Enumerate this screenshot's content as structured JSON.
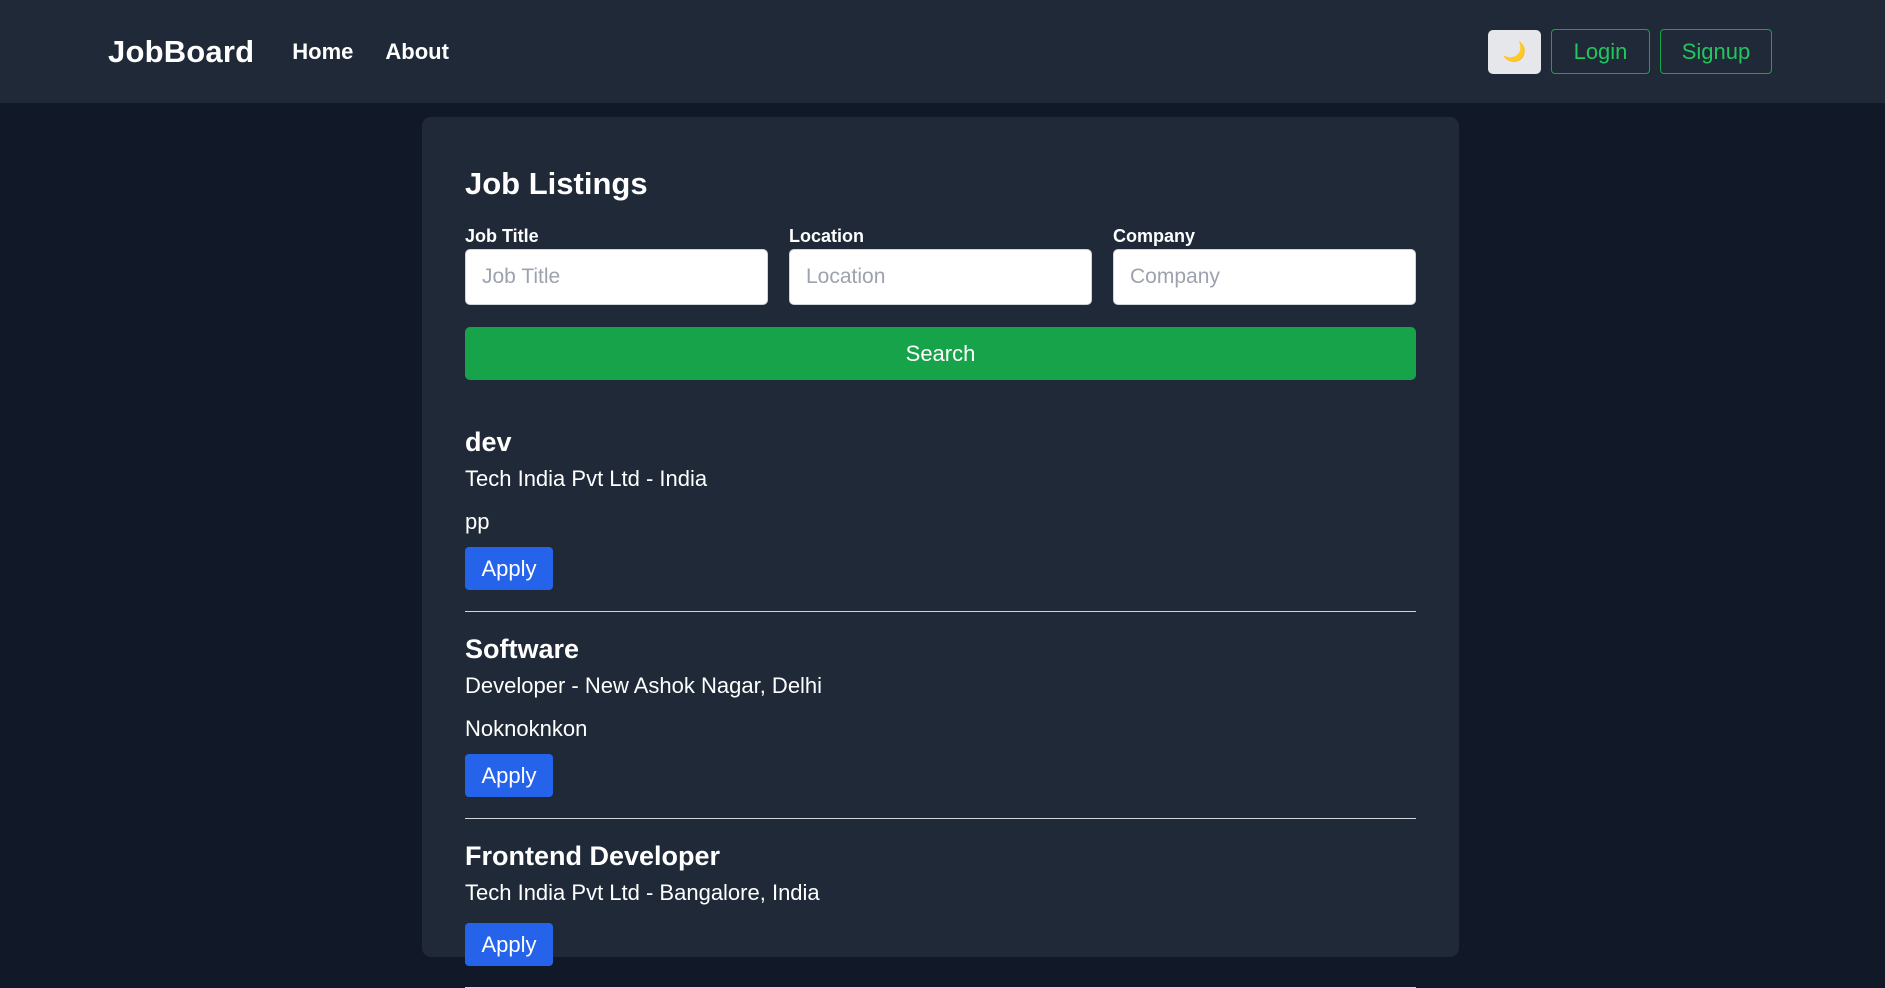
{
  "navbar": {
    "brand": "JobBoard",
    "links": [
      "Home",
      "About"
    ],
    "theme_icon": "🌙",
    "login_label": "Login",
    "signup_label": "Signup"
  },
  "main": {
    "title": "Job Listings",
    "filters": [
      {
        "label": "Job Title",
        "placeholder": "Job Title",
        "value": ""
      },
      {
        "label": "Location",
        "placeholder": "Location",
        "value": ""
      },
      {
        "label": "Company",
        "placeholder": "Company",
        "value": ""
      }
    ],
    "search_label": "Search",
    "jobs": [
      {
        "title": "dev",
        "meta": "Tech India Pvt Ltd - India",
        "description": "pp",
        "apply_label": "Apply"
      },
      {
        "title": "Software",
        "meta": "Developer - New Ashok Nagar, Delhi",
        "description": "Noknoknkon",
        "apply_label": "Apply"
      },
      {
        "title": "Frontend Developer",
        "meta": "Tech India Pvt Ltd - Bangalore, India",
        "description": "",
        "apply_label": "Apply"
      }
    ]
  },
  "colors": {
    "page_bg": "#111827",
    "panel_bg": "#1f2937",
    "accent_green": "#16a34a",
    "accent_blue": "#2563eb"
  }
}
